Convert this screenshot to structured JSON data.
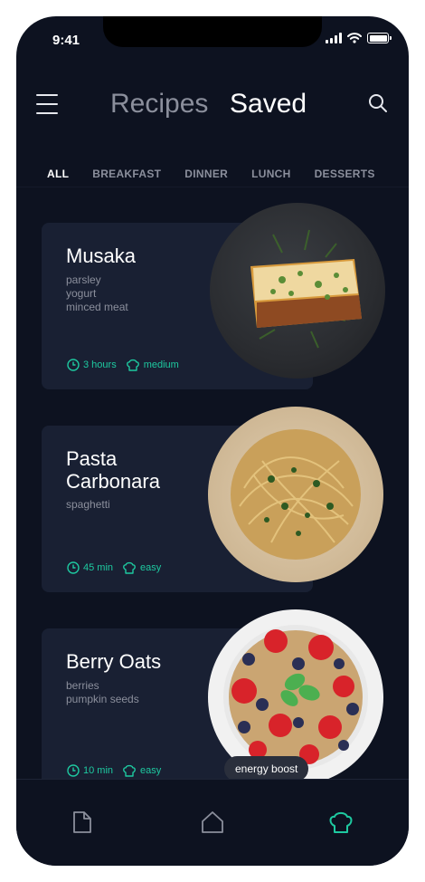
{
  "status_bar": {
    "time": "9:41"
  },
  "header": {
    "title_secondary": "Recipes",
    "title_primary": "Saved"
  },
  "tabs": [
    {
      "label": "ALL",
      "active": true
    },
    {
      "label": "BREAKFAST",
      "active": false
    },
    {
      "label": "DINNER",
      "active": false
    },
    {
      "label": "LUNCH",
      "active": false
    },
    {
      "label": "DESSERTS",
      "active": false
    }
  ],
  "recipes": [
    {
      "title": "Musaka",
      "ingredients": [
        "parsley",
        "yogurt",
        "minced meat"
      ],
      "time": "3 hours",
      "difficulty": "medium"
    },
    {
      "title": "Pasta Carbonara",
      "ingredients": [
        "spaghetti"
      ],
      "time": "45 min",
      "difficulty": "easy"
    },
    {
      "title": "Berry Oats",
      "ingredients": [
        "berries",
        "pumpkin seeds"
      ],
      "time": "10 min",
      "difficulty": "easy"
    }
  ],
  "badge": {
    "label": "energy boost"
  },
  "bottom_nav": [
    {
      "icon": "document-icon",
      "active": false
    },
    {
      "icon": "home-icon",
      "active": false
    },
    {
      "icon": "chef-hat-icon",
      "active": true
    }
  ],
  "colors": {
    "background": "#0d1220",
    "card": "#192033",
    "accent": "#1ec9a0",
    "muted": "#8b8f9c"
  }
}
